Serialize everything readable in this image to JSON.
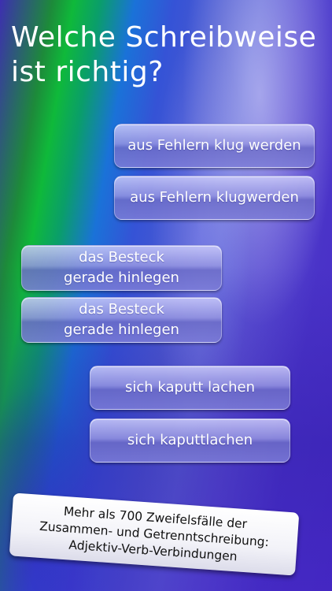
{
  "title": "Welche Schreibweise\nist richtig?",
  "answer_groups": [
    {
      "options": [
        {
          "label": "aus Fehlern klug werden"
        },
        {
          "label": "aus Fehlern klugwerden"
        }
      ]
    },
    {
      "options": [
        {
          "label": "das Besteck\ngerade hinlegen"
        },
        {
          "label": "das Besteck\ngerade hinlegen"
        }
      ]
    },
    {
      "options": [
        {
          "label": "sich kaputt lachen"
        },
        {
          "label": "sich kaputtlachen"
        }
      ]
    }
  ],
  "banner": {
    "text": "Mehr als 700 Zweifelsfälle der\nZusammen- und Getrenntschreibung:\nAdjektiv-Verb-Verbindungen"
  }
}
